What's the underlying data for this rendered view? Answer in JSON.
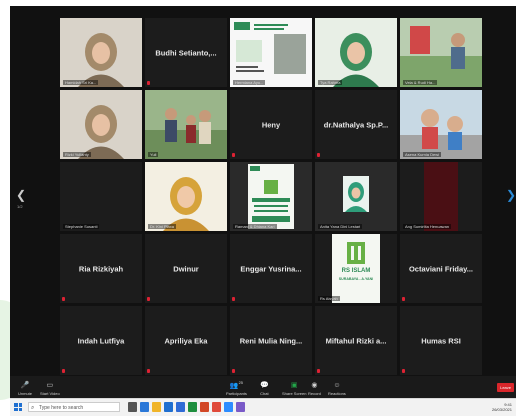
{
  "tiles": [
    {
      "label": "Hamidah Sri Ka...",
      "video": "woman-hijab-webcam",
      "active": true
    },
    {
      "name": "Budhi Setianto,...",
      "label": ""
    },
    {
      "label": "Hermiana Ayu...",
      "video": "webinar-flyer-share"
    },
    {
      "label": "Tya Rahma",
      "video": "woman-green-hijab"
    },
    {
      "label": "Vela & Rudi Ha...",
      "video": "outdoor-photo"
    },
    {
      "label": "Rizki Yulianty",
      "video": "woman-hijab-webcam"
    },
    {
      "label": "Yuli",
      "video": "family-photo"
    },
    {
      "name": "Heny",
      "label": ""
    },
    {
      "name": "dr.Nathalya Sp.P...",
      "label": ""
    },
    {
      "label": "Asena Kurnia Dewi",
      "video": "child-photo"
    },
    {
      "label": "Stephanie Susanti",
      "video": "dark"
    },
    {
      "label": "Dr. Kini Plaxa",
      "video": "woman-yellow-hijab"
    },
    {
      "label": "Ramani & Dhiana Kari",
      "video": "rs-islam-flyer"
    },
    {
      "label": "Anita Yana Dini Lestari",
      "video": "woman-green-hijab-small"
    },
    {
      "label": "Ang Sumirlita Henuawan",
      "video": "dark-red"
    },
    {
      "name": "Ria Rizkiyah",
      "label": ""
    },
    {
      "name": "Dwinur",
      "label": ""
    },
    {
      "name": "Enggar Yusrina...",
      "label": ""
    },
    {
      "label": "Rs Aisyah",
      "video": "rs-islam-logo"
    },
    {
      "name": "Octaviani Friday...",
      "label": ""
    },
    {
      "name": "Indah Lutfiya",
      "label": ""
    },
    {
      "name": "Apriliya Eka",
      "label": ""
    },
    {
      "name": "Reni Mulia Ning...",
      "label": ""
    },
    {
      "name": "Miftahul Rizki a...",
      "label": ""
    },
    {
      "name": "Humas RSI",
      "label": ""
    }
  ],
  "flyer": {
    "title": "RS ISLAM",
    "subtitle": "SURABAYA - A.YANI"
  },
  "nav": {
    "left_arrow": "❮",
    "right_arrow": "❯",
    "page": "1/2"
  },
  "toolbar": {
    "unmute": "Unmute",
    "stop_video": "Start Video",
    "participants": "Participants",
    "participants_count": "25",
    "chat": "Chat",
    "share": "Share Screen",
    "record": "Record",
    "reactions": "Reactions",
    "end": "Leave"
  },
  "taskbar": {
    "search_placeholder": "Type here to search",
    "time": "9:41",
    "date": "26/03/2021"
  },
  "colors": {
    "active_border": "#e9d23b",
    "end_red": "#d9262b",
    "share_green": "#23a74a"
  }
}
